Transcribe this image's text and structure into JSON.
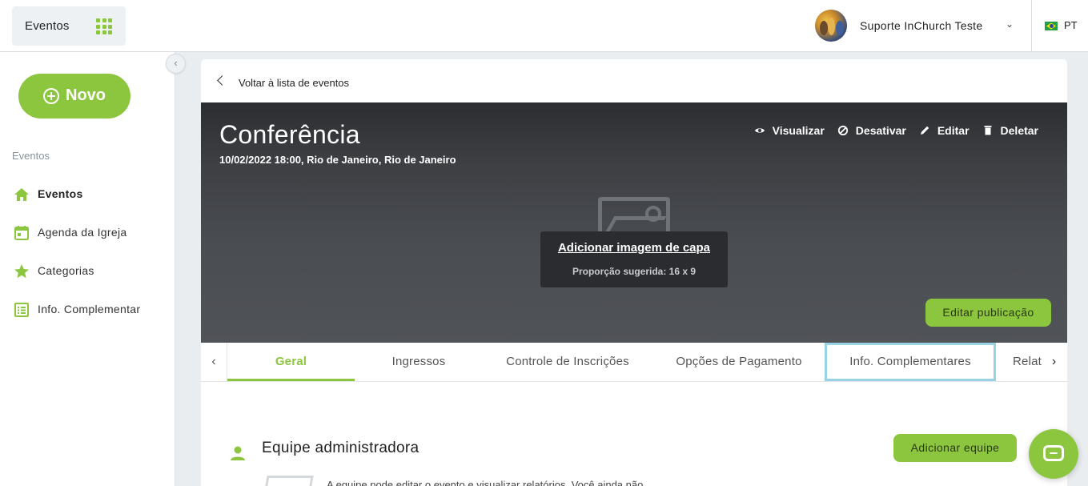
{
  "topbar": {
    "app_label": "Eventos",
    "user_name": "Suporte InChurch Teste",
    "language": "PT"
  },
  "sidebar": {
    "new_button": "Novo",
    "section_label": "Eventos",
    "items": [
      {
        "label": "Eventos",
        "icon": "home-icon",
        "active": true
      },
      {
        "label": "Agenda da Igreja",
        "icon": "calendar-icon",
        "active": false
      },
      {
        "label": "Categorias",
        "icon": "star-icon",
        "active": false
      },
      {
        "label": "Info. Complementar",
        "icon": "list-icon",
        "active": false
      }
    ]
  },
  "main": {
    "back_label": "Voltar à lista de eventos",
    "event": {
      "title": "Conferência",
      "subtitle": "10/02/2022 18:00, Rio de Janeiro, Rio de Janeiro"
    },
    "actions": {
      "view": "Visualizar",
      "deactivate": "Desativar",
      "edit": "Editar",
      "delete": "Deletar"
    },
    "cover": {
      "add_link": "Adicionar imagem de capa",
      "note": "Proporção sugerida: 16 x 9"
    },
    "edit_publication": "Editar publicação",
    "tabs": [
      "Geral",
      "Ingressos",
      "Controle de Inscrições",
      "Opções de Pagamento",
      "Info. Complementares",
      "Relat"
    ],
    "team": {
      "title": "Equipe administradora",
      "add_button": "Adicionar equipe",
      "description": "A equipe pode editar o evento e visualizar relatórios. Você ainda não"
    }
  },
  "colors": {
    "accent": "#8cc63f",
    "focus_outline": "#99d3e3",
    "hero_dark": "#2c2d30"
  }
}
